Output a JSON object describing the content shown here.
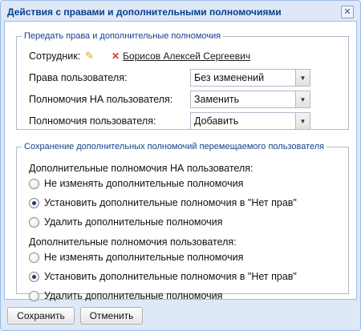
{
  "dialog": {
    "title": "Действия с правами и дополнительными полномочиями",
    "close_glyph": "✕"
  },
  "transfer_section": {
    "legend": "Передать права и дополнительные полномочия",
    "employee_label": "Сотрудник:",
    "employee_name": "Борисов Алексей Сергеевич",
    "fields": [
      {
        "label": "Права пользователя:",
        "value": "Без изменений"
      },
      {
        "label": "Полномочия НА пользователя:",
        "value": "Заменить"
      },
      {
        "label": "Полномочия пользователя:",
        "value": "Добавить"
      }
    ]
  },
  "preserve_section": {
    "legend": "Сохранение дополнительных полномочий перемещаемого пользователя",
    "groups": [
      {
        "title": "Дополнительные полномочия НА пользователя:",
        "options": [
          {
            "label": "Не изменять дополнительные полномочия",
            "checked": false
          },
          {
            "label": "Установить дополнительные полномочия в \"Нет прав\"",
            "checked": true
          },
          {
            "label": "Удалить дополнительные полномочия",
            "checked": false
          }
        ]
      },
      {
        "title": "Дополнительные полномочия пользователя:",
        "options": [
          {
            "label": "Не изменять дополнительные полномочия",
            "checked": false
          },
          {
            "label": "Установить дополнительные полномочия в \"Нет прав\"",
            "checked": true
          },
          {
            "label": "Удалить дополнительные полномочия",
            "checked": false
          }
        ]
      }
    ]
  },
  "footer": {
    "save_label": "Сохранить",
    "cancel_label": "Отменить"
  },
  "icons": {
    "pencil": "✎",
    "remove": "✕",
    "dropdown": "▼"
  },
  "colors": {
    "title": "#04408c",
    "legend": "#15428b",
    "window_border": "#99bce8",
    "remove_icon": "#d9381e",
    "edit_icon": "#e0a020"
  }
}
